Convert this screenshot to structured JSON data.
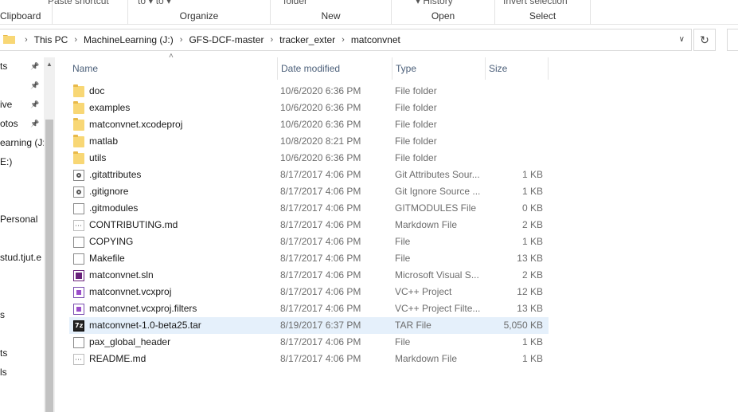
{
  "ribbon": {
    "groups": [
      {
        "label": "Clipboard",
        "cut_text": "Paste shortcut"
      },
      {
        "label": "Organize",
        "cut_text": "to ▾      to ▾"
      },
      {
        "label": "New",
        "cut_text": "folder"
      },
      {
        "label": "Open",
        "cut_text": "▾      History"
      },
      {
        "label": "Select",
        "cut_text": "Invert selection"
      }
    ]
  },
  "address": {
    "crumbs": [
      "This PC",
      "MachineLearning (J:)",
      "GFS-DCF-master",
      "tracker_exter",
      "matconvnet"
    ]
  },
  "nav": {
    "items": [
      {
        "label": "ts",
        "pinned": true
      },
      {
        "label": "",
        "pinned": true
      },
      {
        "label": "ive",
        "pinned": true
      },
      {
        "label": "otos",
        "pinned": true
      },
      {
        "label": "earning (J:",
        "pinned": false
      },
      {
        "label": "E:)",
        "pinned": false
      },
      {
        "label": "",
        "pinned": false
      },
      {
        "label": "",
        "pinned": false
      },
      {
        "label": "Personal",
        "pinned": false
      },
      {
        "label": "",
        "pinned": false
      },
      {
        "label": "stud.tjut.e",
        "pinned": false
      },
      {
        "label": "",
        "pinned": false
      },
      {
        "label": "",
        "pinned": false
      },
      {
        "label": "s",
        "pinned": false
      },
      {
        "label": "",
        "pinned": false
      },
      {
        "label": "ts",
        "pinned": false
      },
      {
        "label": "ls",
        "pinned": false
      }
    ]
  },
  "columns": {
    "name": "Name",
    "date": "Date modified",
    "type": "Type",
    "size": "Size"
  },
  "files": [
    {
      "icon": "folder",
      "name": "doc",
      "date": "10/6/2020 6:36 PM",
      "type": "File folder",
      "size": ""
    },
    {
      "icon": "folder",
      "name": "examples",
      "date": "10/6/2020 6:36 PM",
      "type": "File folder",
      "size": ""
    },
    {
      "icon": "folder",
      "name": "matconvnet.xcodeproj",
      "date": "10/6/2020 6:36 PM",
      "type": "File folder",
      "size": ""
    },
    {
      "icon": "folder",
      "name": "matlab",
      "date": "10/8/2020 8:21 PM",
      "type": "File folder",
      "size": ""
    },
    {
      "icon": "folder",
      "name": "utils",
      "date": "10/6/2020 6:36 PM",
      "type": "File folder",
      "size": ""
    },
    {
      "icon": "gear",
      "name": ".gitattributes",
      "date": "8/17/2017 4:06 PM",
      "type": "Git Attributes Sour...",
      "size": "1 KB"
    },
    {
      "icon": "gear",
      "name": ".gitignore",
      "date": "8/17/2017 4:06 PM",
      "type": "Git Ignore Source ...",
      "size": "1 KB"
    },
    {
      "icon": "file",
      "name": ".gitmodules",
      "date": "8/17/2017 4:06 PM",
      "type": "GITMODULES File",
      "size": "0 KB"
    },
    {
      "icon": "md",
      "name": "CONTRIBUTING.md",
      "date": "8/17/2017 4:06 PM",
      "type": "Markdown File",
      "size": "2 KB"
    },
    {
      "icon": "file",
      "name": "COPYING",
      "date": "8/17/2017 4:06 PM",
      "type": "File",
      "size": "1 KB"
    },
    {
      "icon": "file",
      "name": "Makefile",
      "date": "8/17/2017 4:06 PM",
      "type": "File",
      "size": "13 KB"
    },
    {
      "icon": "sln",
      "name": "matconvnet.sln",
      "date": "8/17/2017 4:06 PM",
      "type": "Microsoft Visual S...",
      "size": "2 KB"
    },
    {
      "icon": "vcx",
      "name": "matconvnet.vcxproj",
      "date": "8/17/2017 4:06 PM",
      "type": "VC++ Project",
      "size": "12 KB"
    },
    {
      "icon": "vcx",
      "name": "matconvnet.vcxproj.filters",
      "date": "8/17/2017 4:06 PM",
      "type": "VC++ Project Filte...",
      "size": "13 KB"
    },
    {
      "icon": "tar",
      "name": "matconvnet-1.0-beta25.tar",
      "date": "8/19/2017 6:37 PM",
      "type": "TAR File",
      "size": "5,050 KB",
      "selected": true
    },
    {
      "icon": "file",
      "name": "pax_global_header",
      "date": "8/17/2017 4:06 PM",
      "type": "File",
      "size": "1 KB"
    },
    {
      "icon": "md",
      "name": "README.md",
      "date": "8/17/2017 4:06 PM",
      "type": "Markdown File",
      "size": "1 KB"
    }
  ]
}
